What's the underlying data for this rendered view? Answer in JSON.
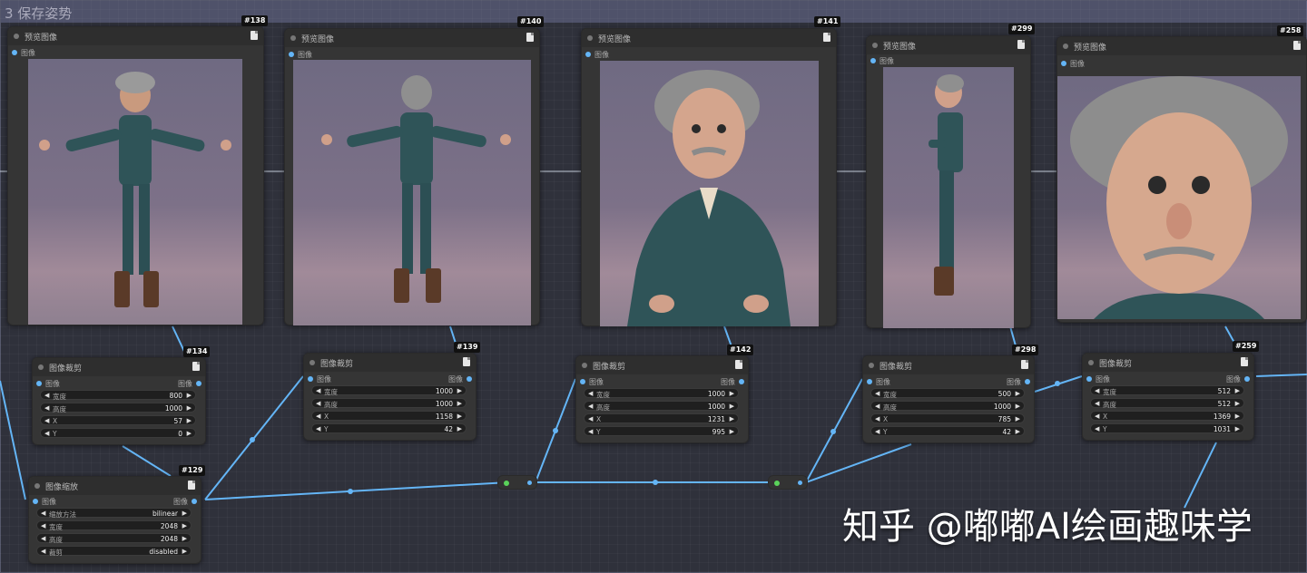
{
  "group": {
    "title": "3 保存姿势"
  },
  "preview_nodes": [
    {
      "id": "#138",
      "title": "预览图像",
      "input": "图像"
    },
    {
      "id": "#140",
      "title": "预览图像",
      "input": "图像"
    },
    {
      "id": "#141",
      "title": "预览图像",
      "input": "图像"
    },
    {
      "id": "#299",
      "title": "预览图像",
      "input": "图像"
    },
    {
      "id": "#258",
      "title": "预览图像",
      "input": "图像"
    }
  ],
  "crop_nodes": [
    {
      "id": "#134",
      "title": "图像裁剪",
      "input": "图像",
      "output": "图像",
      "widgets": [
        {
          "label": "宽度",
          "value": "800"
        },
        {
          "label": "高度",
          "value": "1000"
        },
        {
          "label": "X",
          "value": "57"
        },
        {
          "label": "Y",
          "value": "0"
        }
      ]
    },
    {
      "id": "#139",
      "title": "图像裁剪",
      "input": "图像",
      "output": "图像",
      "widgets": [
        {
          "label": "宽度",
          "value": "1000"
        },
        {
          "label": "高度",
          "value": "1000"
        },
        {
          "label": "X",
          "value": "1158"
        },
        {
          "label": "Y",
          "value": "42"
        }
      ]
    },
    {
      "id": "#142",
      "title": "图像裁剪",
      "input": "图像",
      "output": "图像",
      "widgets": [
        {
          "label": "宽度",
          "value": "1000"
        },
        {
          "label": "高度",
          "value": "1000"
        },
        {
          "label": "X",
          "value": "1231"
        },
        {
          "label": "Y",
          "value": "995"
        }
      ]
    },
    {
      "id": "#298",
      "title": "图像裁剪",
      "input": "图像",
      "output": "图像",
      "widgets": [
        {
          "label": "宽度",
          "value": "500"
        },
        {
          "label": "高度",
          "value": "1000"
        },
        {
          "label": "X",
          "value": "785"
        },
        {
          "label": "Y",
          "value": "42"
        }
      ]
    },
    {
      "id": "#259",
      "title": "图像裁剪",
      "input": "图像",
      "output": "图像",
      "widgets": [
        {
          "label": "宽度",
          "value": "512"
        },
        {
          "label": "高度",
          "value": "512"
        },
        {
          "label": "X",
          "value": "1369"
        },
        {
          "label": "Y",
          "value": "1031"
        }
      ]
    }
  ],
  "scale_node": {
    "id": "#129",
    "title": "图像缩放",
    "input": "图像",
    "output": "图像",
    "widgets": [
      {
        "label": "缩放方法",
        "value": "bilinear"
      },
      {
        "label": "宽度",
        "value": "2048"
      },
      {
        "label": "高度",
        "value": "2048"
      },
      {
        "label": "裁剪",
        "value": "disabled"
      }
    ]
  },
  "watermark": "知乎 @嘟嘟AI绘画趣味学",
  "colors": {
    "link": "#64b5f6",
    "reroute_in": "#5ad35a",
    "node_bg": "#353535",
    "canvas": "#222327"
  }
}
